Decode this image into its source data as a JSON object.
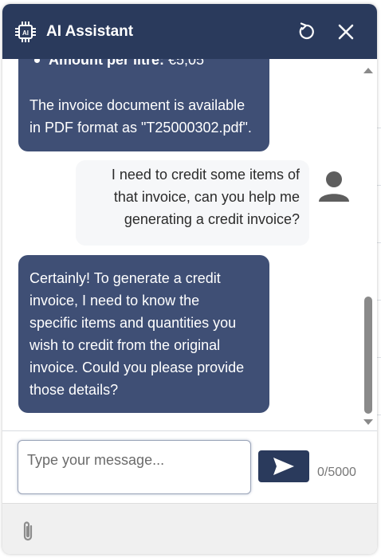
{
  "header": {
    "title": "AI Assistant"
  },
  "messages": [
    {
      "role": "assistant",
      "bullet_label": "Amount per litre:",
      "bullet_value": " €5,05",
      "line1": "The invoice document is available",
      "line2": "in PDF format as \"T25000302.pdf\"."
    },
    {
      "role": "user",
      "line1": "I need to credit some items of",
      "line2": "that invoice, can you help me",
      "line3": "generating a credit invoice?"
    },
    {
      "role": "assistant",
      "line1": "Certainly! To generate a credit",
      "line2": "invoice, I need to know the",
      "line3": "specific items and quantities you",
      "line4": "wish to credit from the original",
      "line5": "invoice. Could you please provide",
      "line6": "those details?"
    }
  ],
  "composer": {
    "placeholder": "Type your message...",
    "value": "",
    "counter": "0/5000"
  },
  "icons": {
    "header_left": "ai-chip-icon",
    "reset": "refresh-icon",
    "close": "close-icon",
    "avatar": "user-avatar-icon",
    "send": "send-icon",
    "attach": "paperclip-icon"
  },
  "colors": {
    "header_bg": "#2a3a5c",
    "bot_bubble": "#3f4f75",
    "user_bubble": "#f6f7f9",
    "send_button": "#2a3a5c"
  }
}
